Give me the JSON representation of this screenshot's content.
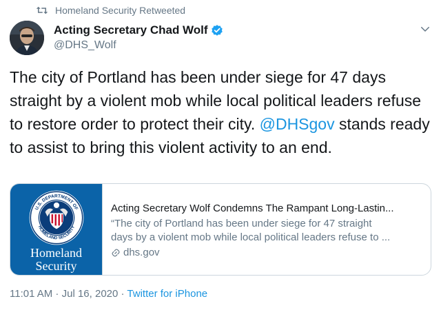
{
  "retweet": {
    "icon": "retweet-icon",
    "label": "Homeland Security Retweeted"
  },
  "author": {
    "display_name": "Acting Secretary Chad Wolf",
    "handle": "@DHS_Wolf",
    "verified": true,
    "avatar_icon": "avatar-photo"
  },
  "menu": {
    "icon": "chevron-down-icon"
  },
  "tweet": {
    "text_part1": "The city of Portland has been under siege for 47 days straight by a violent mob while local political leaders refuse to restore order to protect their city. ",
    "mention": "@DHSgov",
    "text_part2": " stands ready to assist to bring this violent activity to an end."
  },
  "card": {
    "brand_line1": "Homeland",
    "brand_line2": "Security",
    "seal_text": "U.S. DEPARTMENT OF HOMELAND SECURITY",
    "title": "Acting Secretary Wolf Condemns The Rampant Long-Lastin...",
    "description_line1": "“The city of Portland has been under siege for 47 straight",
    "description_line2": "days by a violent mob while local political leaders refuse to ...",
    "domain": "dhs.gov"
  },
  "meta": {
    "time": "11:01 AM",
    "separator": " · ",
    "date": "Jul 16, 2020",
    "source": "Twitter for iPhone"
  },
  "colors": {
    "accent": "#1b95e0",
    "secondary_text": "#657786",
    "border": "#ccd6dd",
    "dhs_blue": "#0b63a8"
  }
}
